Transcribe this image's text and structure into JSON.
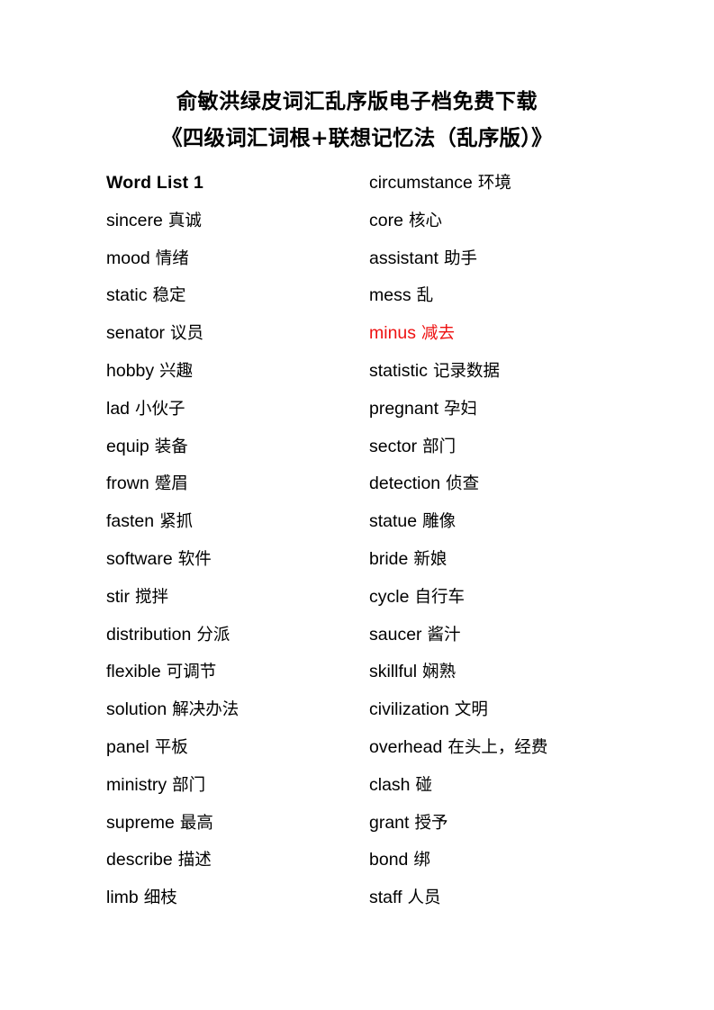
{
  "document": {
    "background_color": "#ffffff",
    "text_color": "#000000",
    "accent_color": "#ee1111",
    "title_line_1": "俞敏洪绿皮词汇乱序版电子档免费下载",
    "title_line_2": "《四级词汇词根+联想记忆法（乱序版）》"
  },
  "word_list": {
    "heading": "Word List 1",
    "rows": [
      {
        "left": {
          "english": "Word List 1",
          "chinese": "",
          "heading": true,
          "accent": false
        },
        "right": {
          "english": "circumstance",
          "chinese": "环境",
          "heading": false,
          "accent": false
        }
      },
      {
        "left": {
          "english": "sincere",
          "chinese": "真诚",
          "heading": false,
          "accent": false
        },
        "right": {
          "english": "core",
          "chinese": "核心",
          "heading": false,
          "accent": false
        }
      },
      {
        "left": {
          "english": "mood",
          "chinese": "情绪",
          "heading": false,
          "accent": false
        },
        "right": {
          "english": "assistant",
          "chinese": "助手",
          "heading": false,
          "accent": false
        }
      },
      {
        "left": {
          "english": "static",
          "chinese": "稳定",
          "heading": false,
          "accent": false
        },
        "right": {
          "english": "mess",
          "chinese": "乱",
          "heading": false,
          "accent": false
        }
      },
      {
        "left": {
          "english": "senator",
          "chinese": "议员",
          "heading": false,
          "accent": false
        },
        "right": {
          "english": "minus",
          "chinese": "减去",
          "heading": false,
          "accent": true
        }
      },
      {
        "left": {
          "english": "hobby",
          "chinese": "兴趣",
          "heading": false,
          "accent": false
        },
        "right": {
          "english": "statistic",
          "chinese": "记录数据",
          "heading": false,
          "accent": false
        }
      },
      {
        "left": {
          "english": "lad",
          "chinese": "小伙子",
          "heading": false,
          "accent": false
        },
        "right": {
          "english": "pregnant",
          "chinese": "孕妇",
          "heading": false,
          "accent": false
        }
      },
      {
        "left": {
          "english": "equip",
          "chinese": "装备",
          "heading": false,
          "accent": false
        },
        "right": {
          "english": "sector",
          "chinese": "部门",
          "heading": false,
          "accent": false
        }
      },
      {
        "left": {
          "english": "frown",
          "chinese": "蹙眉",
          "heading": false,
          "accent": false
        },
        "right": {
          "english": "detection",
          "chinese": "侦查",
          "heading": false,
          "accent": false
        }
      },
      {
        "left": {
          "english": "fasten",
          "chinese": "紧抓",
          "heading": false,
          "accent": false
        },
        "right": {
          "english": "statue",
          "chinese": "雕像",
          "heading": false,
          "accent": false
        }
      },
      {
        "left": {
          "english": "software",
          "chinese": "软件",
          "heading": false,
          "accent": false
        },
        "right": {
          "english": "bride",
          "chinese": "新娘",
          "heading": false,
          "accent": false
        }
      },
      {
        "left": {
          "english": "stir",
          "chinese": "搅拌",
          "heading": false,
          "accent": false
        },
        "right": {
          "english": "cycle",
          "chinese": "自行车",
          "heading": false,
          "accent": false
        }
      },
      {
        "left": {
          "english": "distribution",
          "chinese": "分派",
          "heading": false,
          "accent": false
        },
        "right": {
          "english": "saucer",
          "chinese": "酱汁",
          "heading": false,
          "accent": false
        }
      },
      {
        "left": {
          "english": "flexible",
          "chinese": "可调节",
          "heading": false,
          "accent": false
        },
        "right": {
          "english": "skillful",
          "chinese": "娴熟",
          "heading": false,
          "accent": false
        }
      },
      {
        "left": {
          "english": "solution",
          "chinese": "解决办法",
          "heading": false,
          "accent": false
        },
        "right": {
          "english": "civilization",
          "chinese": "文明",
          "heading": false,
          "accent": false
        }
      },
      {
        "left": {
          "english": "panel",
          "chinese": "平板",
          "heading": false,
          "accent": false
        },
        "right": {
          "english": "overhead",
          "chinese": "在头上，经费",
          "heading": false,
          "accent": false
        }
      },
      {
        "left": {
          "english": "ministry",
          "chinese": "部门",
          "heading": false,
          "accent": false
        },
        "right": {
          "english": "clash",
          "chinese": "碰",
          "heading": false,
          "accent": false
        }
      },
      {
        "left": {
          "english": "supreme",
          "chinese": "最高",
          "heading": false,
          "accent": false
        },
        "right": {
          "english": "grant",
          "chinese": "授予",
          "heading": false,
          "accent": false
        }
      },
      {
        "left": {
          "english": "describe",
          "chinese": "描述",
          "heading": false,
          "accent": false
        },
        "right": {
          "english": "bond",
          "chinese": "绑",
          "heading": false,
          "accent": false
        }
      },
      {
        "left": {
          "english": "limb",
          "chinese": "细枝",
          "heading": false,
          "accent": false
        },
        "right": {
          "english": "staff",
          "chinese": "人员",
          "heading": false,
          "accent": false
        }
      }
    ]
  }
}
